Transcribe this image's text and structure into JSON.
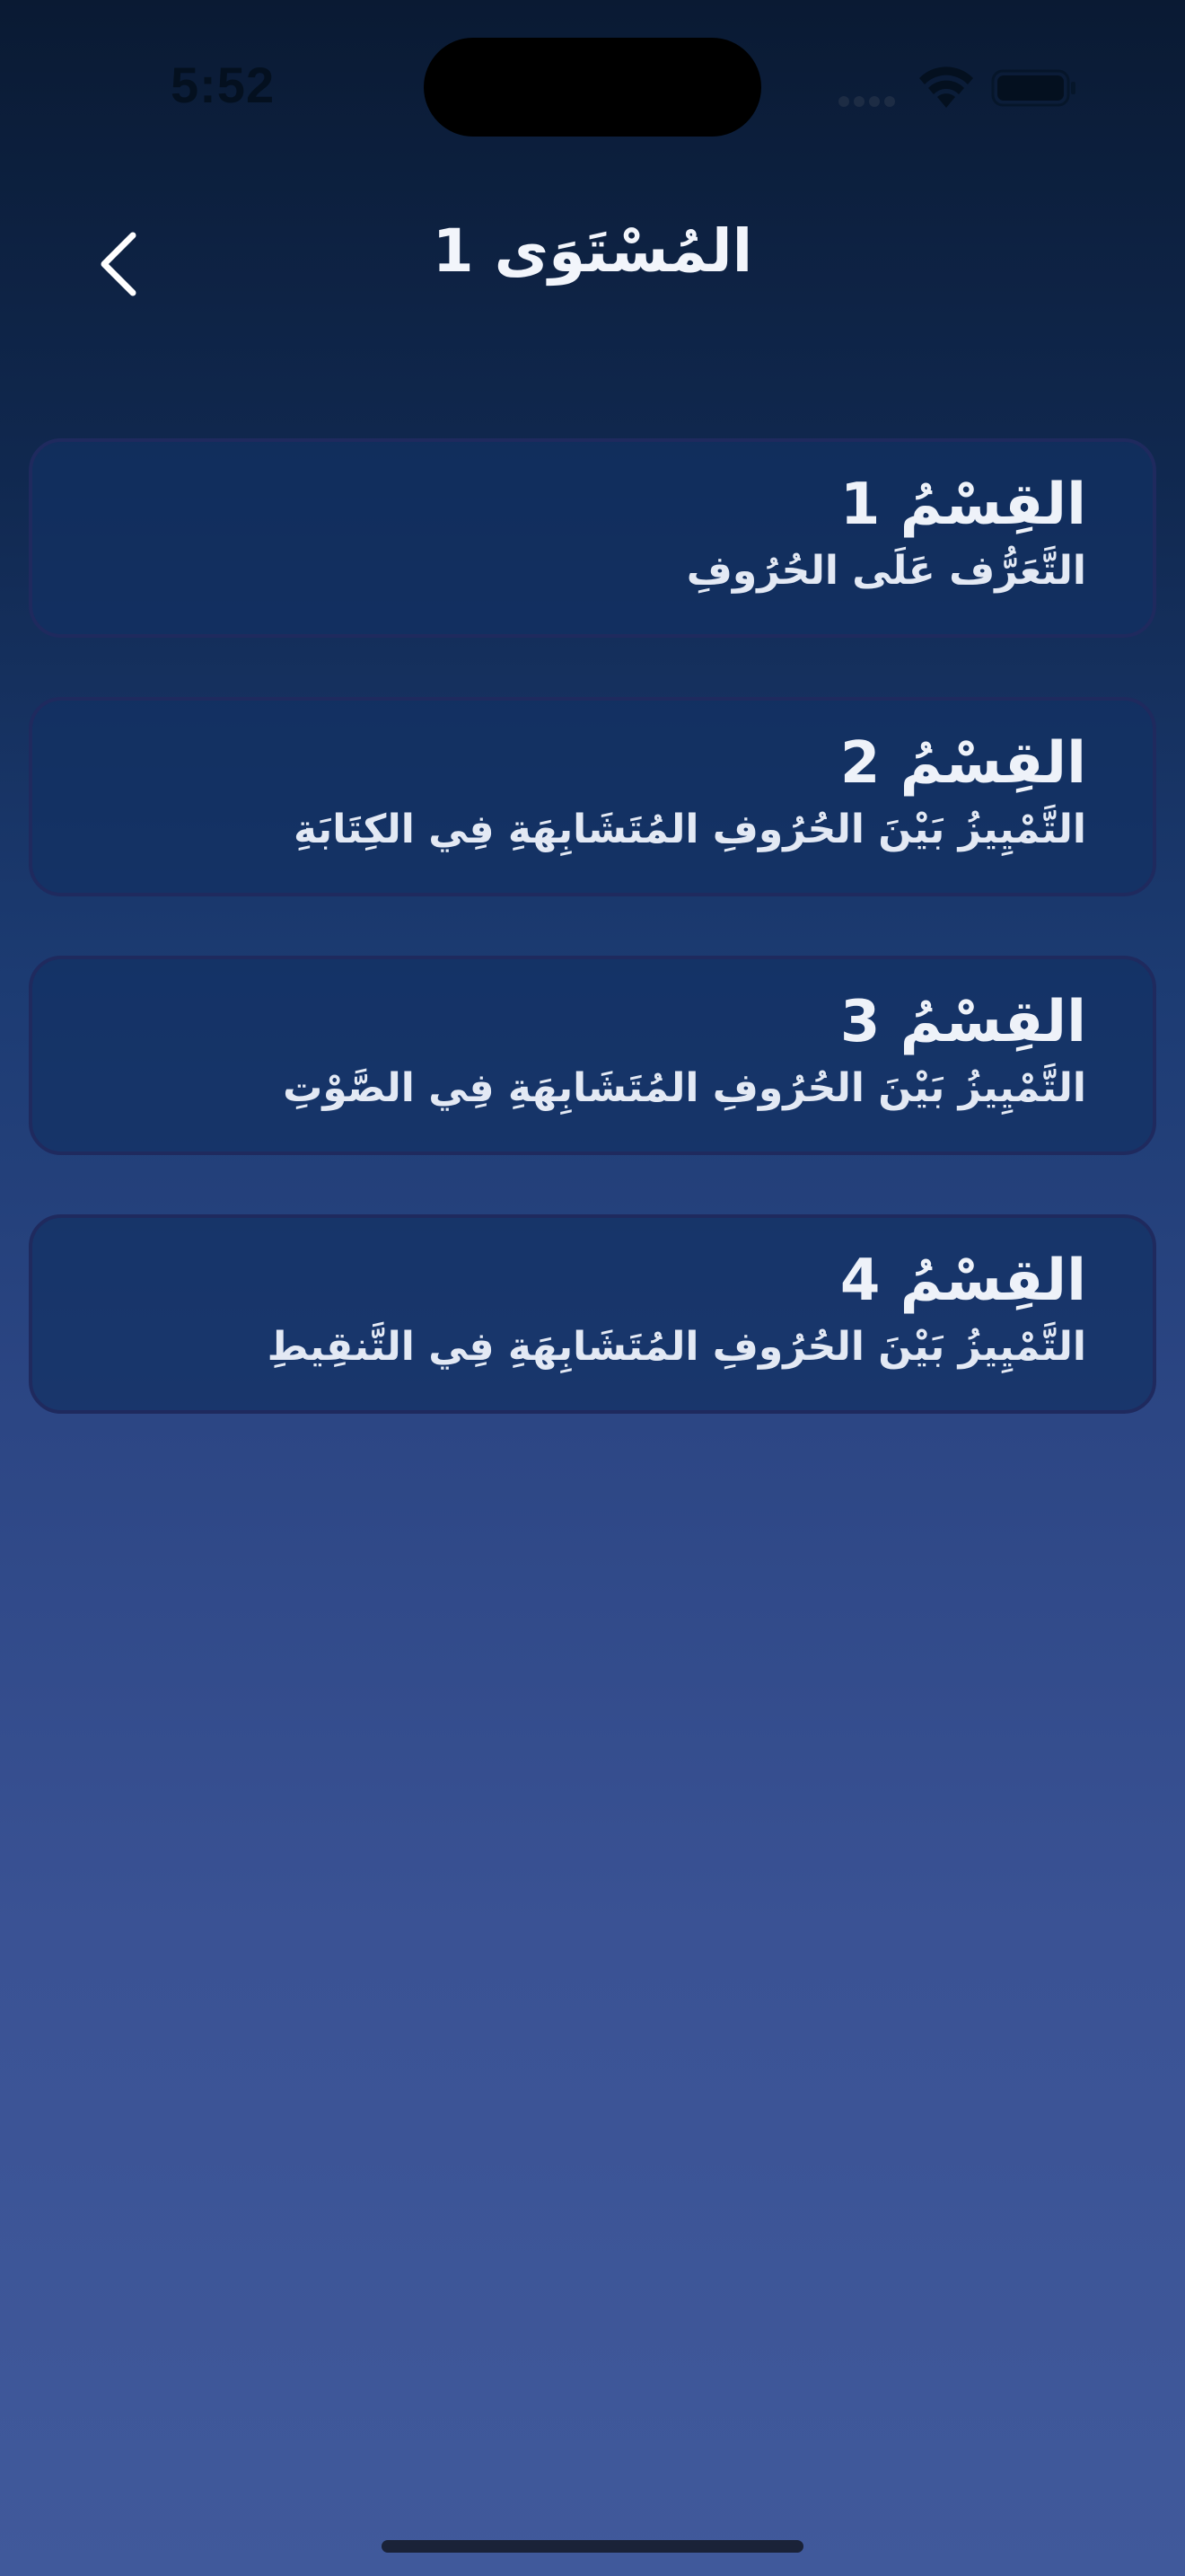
{
  "status_bar": {
    "time": "5:52",
    "icons": [
      "cellular-signal-icon",
      "wifi-icon",
      "battery-icon"
    ]
  },
  "header": {
    "back_icon": "chevron-left-icon",
    "title": "المُسْتَوَى 1"
  },
  "sections": [
    {
      "title": "القِسْمُ 1",
      "subtitle": "التَّعَرُّف عَلَى الحُرُوفِ"
    },
    {
      "title": "القِسْمُ 2",
      "subtitle": "التَّمْيِيزُ بَيْنَ الحُرُوفِ المُتَشَابِهَةِ فِي الكِتَابَةِ"
    },
    {
      "title": "القِسْمُ 3",
      "subtitle": "التَّمْيِيزُ بَيْنَ الحُرُوفِ المُتَشَابِهَةِ فِي الصَّوْتِ"
    },
    {
      "title": "القِسْمُ 4",
      "subtitle": "التَّمْيِيزُ بَيْنَ الحُرُوفِ المُتَشَابِهَةِ فِي التَّنقِيطِ"
    }
  ],
  "colors": {
    "background_top": "#0a1a33",
    "background_bottom": "#40599b",
    "card_background": "#123062",
    "card_border": "#1f2a5e",
    "text": "#eef2f9"
  }
}
